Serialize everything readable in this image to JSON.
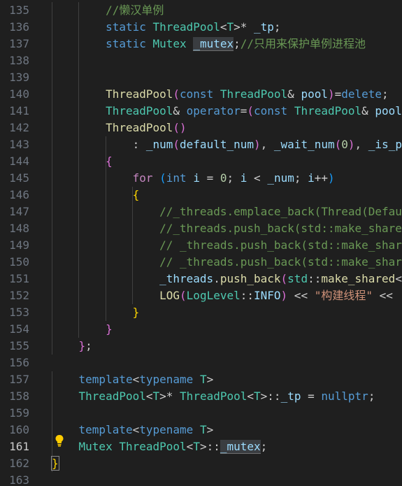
{
  "colors": {
    "background": "#1f1f1f",
    "line_number": "#6e7681",
    "comment": "#6a9955",
    "keyword": "#569cd6",
    "control": "#c586c0",
    "type": "#4ec9b0",
    "function": "#dcdcaa",
    "variable": "#9cdcfe",
    "number": "#b5cea8",
    "string": "#ce9178",
    "text": "#cccccc",
    "bracket_gold": "#ffd700",
    "bracket_orchid": "#da70d6",
    "bracket_blue": "#179fff"
  },
  "editor": {
    "lines": [
      {
        "num": "135",
        "indent": "        ",
        "tokens": [
          {
            "t": "//懒汉单例",
            "c": "comment"
          }
        ]
      },
      {
        "num": "136",
        "indent": "        ",
        "tokens": [
          {
            "t": "static",
            "c": "keyword"
          },
          {
            "t": " ",
            "c": "text"
          },
          {
            "t": "ThreadPool",
            "c": "type"
          },
          {
            "t": "<",
            "c": "text"
          },
          {
            "t": "T",
            "c": "type"
          },
          {
            "t": ">* ",
            "c": "text"
          },
          {
            "t": "_tp",
            "c": "variable"
          },
          {
            "t": ";",
            "c": "text"
          }
        ]
      },
      {
        "num": "137",
        "indent": "        ",
        "tokens": [
          {
            "t": "static",
            "c": "keyword"
          },
          {
            "t": " ",
            "c": "text"
          },
          {
            "t": "Mutex",
            "c": "type"
          },
          {
            "t": " ",
            "c": "text"
          },
          {
            "t": "_mutex",
            "c": "variable",
            "hl": "mutex"
          },
          {
            "t": ";",
            "c": "text"
          },
          {
            "t": "//只用来保护单例进程池",
            "c": "comment"
          }
        ]
      },
      {
        "num": "138",
        "indent": "",
        "tokens": []
      },
      {
        "num": "139",
        "indent": "",
        "tokens": []
      },
      {
        "num": "140",
        "indent": "        ",
        "tokens": [
          {
            "t": "ThreadPool",
            "c": "function"
          },
          {
            "t": "(",
            "c": "bracket_orchid"
          },
          {
            "t": "const",
            "c": "keyword"
          },
          {
            "t": " ",
            "c": "text"
          },
          {
            "t": "ThreadPool",
            "c": "type"
          },
          {
            "t": "& ",
            "c": "text"
          },
          {
            "t": "pool",
            "c": "variable"
          },
          {
            "t": ")",
            "c": "bracket_orchid"
          },
          {
            "t": "=",
            "c": "text"
          },
          {
            "t": "delete",
            "c": "keyword"
          },
          {
            "t": ";",
            "c": "text"
          }
        ]
      },
      {
        "num": "141",
        "indent": "        ",
        "tokens": [
          {
            "t": "ThreadPool",
            "c": "type"
          },
          {
            "t": "& ",
            "c": "text"
          },
          {
            "t": "operator",
            "c": "keyword"
          },
          {
            "t": "=",
            "c": "text"
          },
          {
            "t": "(",
            "c": "bracket_orchid"
          },
          {
            "t": "const",
            "c": "keyword"
          },
          {
            "t": " ",
            "c": "text"
          },
          {
            "t": "ThreadPool",
            "c": "type"
          },
          {
            "t": "& ",
            "c": "text"
          },
          {
            "t": "pool",
            "c": "variable"
          }
        ]
      },
      {
        "num": "142",
        "indent": "        ",
        "tokens": [
          {
            "t": "ThreadPool",
            "c": "function"
          },
          {
            "t": "()",
            "c": "bracket_orchid"
          }
        ]
      },
      {
        "num": "143",
        "indent": "            ",
        "tokens": [
          {
            "t": ": ",
            "c": "text"
          },
          {
            "t": "_num",
            "c": "variable"
          },
          {
            "t": "(",
            "c": "bracket_orchid"
          },
          {
            "t": "default_num",
            "c": "variable"
          },
          {
            "t": ")",
            "c": "bracket_orchid"
          },
          {
            "t": ", ",
            "c": "text"
          },
          {
            "t": "_wait_num",
            "c": "variable"
          },
          {
            "t": "(",
            "c": "bracket_orchid"
          },
          {
            "t": "0",
            "c": "number"
          },
          {
            "t": ")",
            "c": "bracket_orchid"
          },
          {
            "t": ", ",
            "c": "text"
          },
          {
            "t": "_is_p",
            "c": "variable"
          }
        ]
      },
      {
        "num": "144",
        "indent": "        ",
        "tokens": [
          {
            "t": "{",
            "c": "bracket_orchid"
          }
        ]
      },
      {
        "num": "145",
        "indent": "            ",
        "tokens": [
          {
            "t": "for",
            "c": "control"
          },
          {
            "t": " ",
            "c": "text"
          },
          {
            "t": "(",
            "c": "bracket_blue"
          },
          {
            "t": "int",
            "c": "keyword"
          },
          {
            "t": " ",
            "c": "text"
          },
          {
            "t": "i",
            "c": "variable"
          },
          {
            "t": " = ",
            "c": "text"
          },
          {
            "t": "0",
            "c": "number"
          },
          {
            "t": "; ",
            "c": "text"
          },
          {
            "t": "i",
            "c": "variable"
          },
          {
            "t": " < ",
            "c": "text"
          },
          {
            "t": "_num",
            "c": "variable"
          },
          {
            "t": "; ",
            "c": "text"
          },
          {
            "t": "i",
            "c": "variable"
          },
          {
            "t": "++",
            "c": "text"
          },
          {
            "t": ")",
            "c": "bracket_blue"
          }
        ]
      },
      {
        "num": "146",
        "indent": "            ",
        "tokens": [
          {
            "t": "{",
            "c": "bracket_gold"
          }
        ]
      },
      {
        "num": "147",
        "indent": "                ",
        "tokens": [
          {
            "t": "//_threads.emplace_back(Thread(Defau",
            "c": "comment"
          }
        ]
      },
      {
        "num": "148",
        "indent": "                ",
        "tokens": [
          {
            "t": "//_threads.push_back(std::make_share",
            "c": "comment"
          }
        ]
      },
      {
        "num": "149",
        "indent": "                ",
        "tokens": [
          {
            "t": "// _threads.push_back(std::make_shar",
            "c": "comment"
          }
        ]
      },
      {
        "num": "150",
        "indent": "                ",
        "tokens": [
          {
            "t": "// _threads.push_back(std::make_shar",
            "c": "comment"
          }
        ]
      },
      {
        "num": "151",
        "indent": "                ",
        "tokens": [
          {
            "t": "_threads",
            "c": "variable"
          },
          {
            "t": ".",
            "c": "text"
          },
          {
            "t": "push_back",
            "c": "function"
          },
          {
            "t": "(",
            "c": "bracket_orchid"
          },
          {
            "t": "std",
            "c": "type"
          },
          {
            "t": "::",
            "c": "text"
          },
          {
            "t": "make_shared",
            "c": "function"
          },
          {
            "t": "<",
            "c": "text"
          }
        ]
      },
      {
        "num": "152",
        "indent": "                ",
        "tokens": [
          {
            "t": "LOG",
            "c": "function"
          },
          {
            "t": "(",
            "c": "bracket_orchid"
          },
          {
            "t": "LogLevel",
            "c": "type"
          },
          {
            "t": "::",
            "c": "text"
          },
          {
            "t": "INFO",
            "c": "variable"
          },
          {
            "t": ")",
            "c": "bracket_orchid"
          },
          {
            "t": " << ",
            "c": "text"
          },
          {
            "t": "\"构建线程\"",
            "c": "string"
          },
          {
            "t": " <<",
            "c": "text"
          }
        ]
      },
      {
        "num": "153",
        "indent": "            ",
        "tokens": [
          {
            "t": "}",
            "c": "bracket_gold"
          }
        ]
      },
      {
        "num": "154",
        "indent": "        ",
        "tokens": [
          {
            "t": "}",
            "c": "bracket_orchid"
          }
        ]
      },
      {
        "num": "155",
        "indent": "    ",
        "tokens": [
          {
            "t": "}",
            "c": "bracket_orchid"
          },
          {
            "t": ";",
            "c": "text"
          }
        ]
      },
      {
        "num": "156",
        "indent": "",
        "tokens": []
      },
      {
        "num": "157",
        "indent": "    ",
        "tokens": [
          {
            "t": "template",
            "c": "keyword"
          },
          {
            "t": "<",
            "c": "text"
          },
          {
            "t": "typename",
            "c": "keyword"
          },
          {
            "t": " ",
            "c": "text"
          },
          {
            "t": "T",
            "c": "type"
          },
          {
            "t": ">",
            "c": "text"
          }
        ]
      },
      {
        "num": "158",
        "indent": "    ",
        "tokens": [
          {
            "t": "ThreadPool",
            "c": "type"
          },
          {
            "t": "<",
            "c": "text"
          },
          {
            "t": "T",
            "c": "type"
          },
          {
            "t": ">* ",
            "c": "text"
          },
          {
            "t": "ThreadPool",
            "c": "type"
          },
          {
            "t": "<",
            "c": "text"
          },
          {
            "t": "T",
            "c": "type"
          },
          {
            "t": ">::",
            "c": "text"
          },
          {
            "t": "_tp",
            "c": "variable"
          },
          {
            "t": " = ",
            "c": "text"
          },
          {
            "t": "nullptr",
            "c": "keyword"
          },
          {
            "t": ";",
            "c": "text"
          }
        ]
      },
      {
        "num": "159",
        "indent": "",
        "tokens": []
      },
      {
        "num": "160",
        "indent": "    ",
        "tokens": [
          {
            "t": "template",
            "c": "keyword"
          },
          {
            "t": "<",
            "c": "text"
          },
          {
            "t": "typename",
            "c": "keyword"
          },
          {
            "t": " ",
            "c": "text"
          },
          {
            "t": "T",
            "c": "type"
          },
          {
            "t": ">",
            "c": "text"
          }
        ]
      },
      {
        "num": "161",
        "indent": "    ",
        "tokens": [
          {
            "t": "Mutex",
            "c": "type"
          },
          {
            "t": " ",
            "c": "text"
          },
          {
            "t": "ThreadPool",
            "c": "type"
          },
          {
            "t": "<",
            "c": "text"
          },
          {
            "t": "T",
            "c": "type"
          },
          {
            "t": ">::",
            "c": "text"
          },
          {
            "t": "_mutex",
            "c": "variable",
            "hl": "mutex"
          },
          {
            "t": ";",
            "c": "text"
          }
        ]
      },
      {
        "num": "162",
        "indent": "",
        "tokens": [
          {
            "t": "}",
            "c": "bracket_gold",
            "hl": "brace"
          }
        ]
      },
      {
        "num": "163",
        "indent": "",
        "tokens": []
      }
    ],
    "active_line": "161",
    "lightbulb_icon": "lightbulb-icon"
  }
}
